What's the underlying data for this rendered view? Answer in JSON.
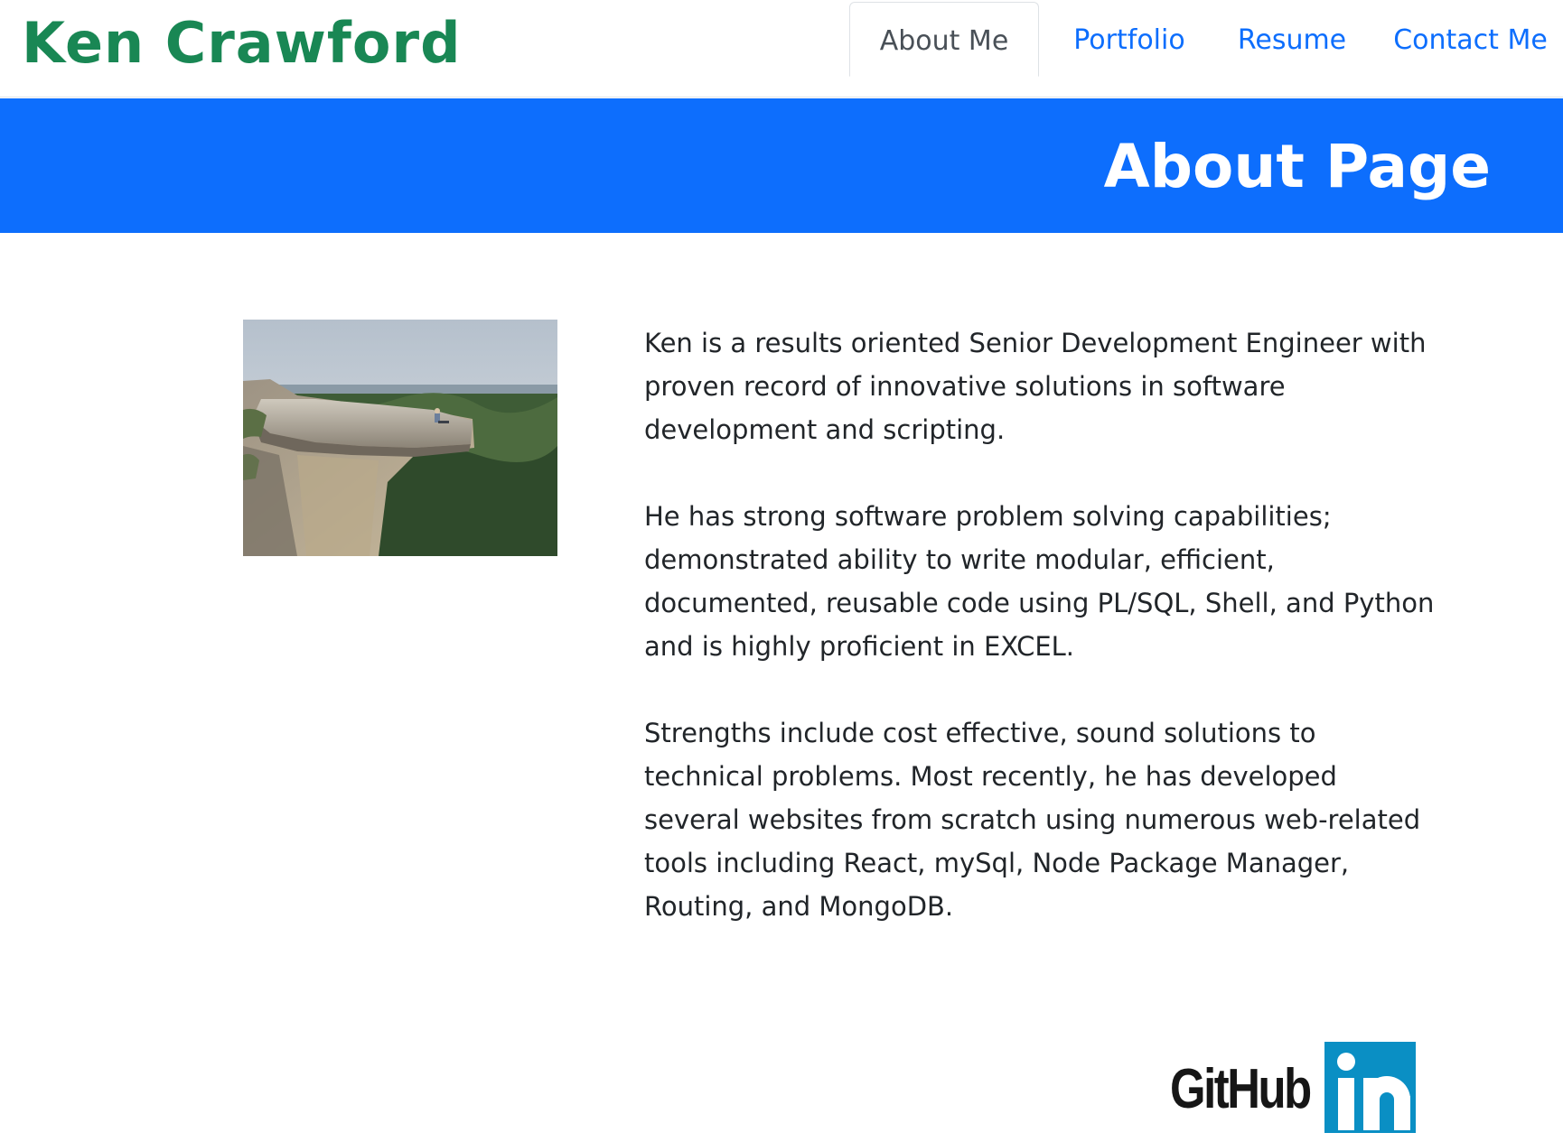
{
  "header": {
    "brand": "Ken Crawford",
    "nav": [
      {
        "label": "About Me",
        "active": true
      },
      {
        "label": "Portfolio",
        "active": false
      },
      {
        "label": "Resume",
        "active": false
      },
      {
        "label": "Contact Me",
        "active": false
      }
    ]
  },
  "banner": {
    "title": "About Page"
  },
  "photo": {
    "icon": "profile-photo-cliff-edge"
  },
  "bio": {
    "paragraphs": [
      "Ken is a results oriented Senior Development Engineer with proven record of innovative solutions in software development and scripting.",
      "He has strong software problem solving capabilities; demonstrated ability to write modular, efficient, documented, reusable code using PL/SQL, Shell, and Python and is highly proficient in EXCEL.",
      "Strengths include cost effective, sound solutions to technical problems. Most recently, he has developed several websites from scratch using numerous web-related tools including React, mySql, Node Package Manager, Routing, and MongoDB."
    ]
  },
  "social": {
    "github_label": "GitHub",
    "linkedin_label": "in",
    "linkedin_color": "#0a8fc4"
  },
  "colors": {
    "brand": "#198754",
    "link": "#0d6efd",
    "banner": "#0d6efd"
  }
}
